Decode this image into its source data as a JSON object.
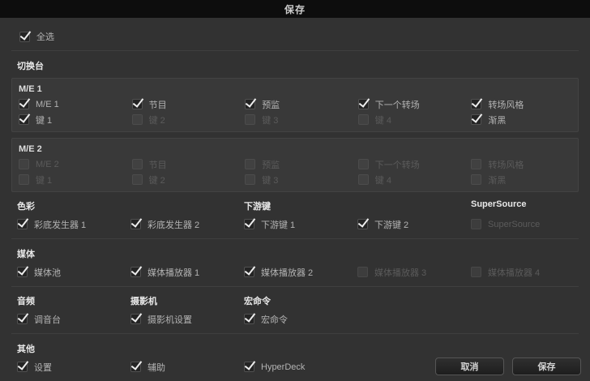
{
  "dialog": {
    "title": "保存",
    "colors": {
      "titlebar_bg": "#0d0d0d",
      "dialog_bg": "#323232",
      "panel_bg": "#393939",
      "separator": "#3f3f3f",
      "header_text": "#e8e8e8",
      "label_text": "#b3b3b3",
      "label_disabled": "#5b5b5b",
      "checkmark": "#ececec"
    }
  },
  "select_all": {
    "label": "全选",
    "state": "checked"
  },
  "switcher": {
    "header": "切换台",
    "me1": {
      "header": "M/E 1",
      "rows": [
        [
          {
            "label": "M/E 1",
            "state": "checked"
          },
          {
            "label": "节目",
            "state": "checked"
          },
          {
            "label": "预监",
            "state": "checked"
          },
          {
            "label": "下一个转场",
            "state": "checked"
          },
          {
            "label": "转场风格",
            "state": "checked"
          }
        ],
        [
          {
            "label": "键 1",
            "state": "checked"
          },
          {
            "label": "键 2",
            "state": "disabled"
          },
          {
            "label": "键 3",
            "state": "disabled"
          },
          {
            "label": "键 4",
            "state": "disabled"
          },
          {
            "label": "渐黑",
            "state": "checked"
          }
        ]
      ]
    },
    "me2": {
      "header": "M/E 2",
      "rows": [
        [
          {
            "label": "M/E 2",
            "state": "disabled"
          },
          {
            "label": "节目",
            "state": "disabled"
          },
          {
            "label": "预监",
            "state": "disabled"
          },
          {
            "label": "下一个转场",
            "state": "disabled"
          },
          {
            "label": "转场风格",
            "state": "disabled"
          }
        ],
        [
          {
            "label": "键 1",
            "state": "disabled"
          },
          {
            "label": "键 2",
            "state": "disabled"
          },
          {
            "label": "键 3",
            "state": "disabled"
          },
          {
            "label": "键 4",
            "state": "disabled"
          },
          {
            "label": "渐黑",
            "state": "disabled"
          }
        ]
      ]
    }
  },
  "color_section": {
    "headers": [
      "色彩",
      "下游键",
      "SuperSource"
    ],
    "items": [
      {
        "label": "彩底发生器 1",
        "state": "checked"
      },
      {
        "label": "彩底发生器 2",
        "state": "checked"
      },
      {
        "label": "下游键 1",
        "state": "checked"
      },
      {
        "label": "下游键 2",
        "state": "checked"
      },
      {
        "label": "SuperSource",
        "state": "disabled"
      }
    ]
  },
  "media_section": {
    "header": "媒体",
    "items": [
      {
        "label": "媒体池",
        "state": "checked"
      },
      {
        "label": "媒体播放器 1",
        "state": "checked"
      },
      {
        "label": "媒体播放器 2",
        "state": "checked"
      },
      {
        "label": "媒体播放器 3",
        "state": "disabled"
      },
      {
        "label": "媒体播放器 4",
        "state": "disabled"
      }
    ]
  },
  "audio_section": {
    "headers": [
      "音频",
      "摄影机",
      "宏命令"
    ],
    "items": [
      {
        "label": "调音台",
        "state": "checked"
      },
      {
        "label": "摄影机设置",
        "state": "checked"
      },
      {
        "label": "宏命令",
        "state": "checked"
      }
    ]
  },
  "other_section": {
    "header": "其他",
    "items": [
      {
        "label": "设置",
        "state": "checked"
      },
      {
        "label": "辅助",
        "state": "checked"
      },
      {
        "label": "HyperDeck",
        "state": "checked"
      }
    ]
  },
  "footer": {
    "cancel_label": "取消",
    "save_label": "保存"
  }
}
